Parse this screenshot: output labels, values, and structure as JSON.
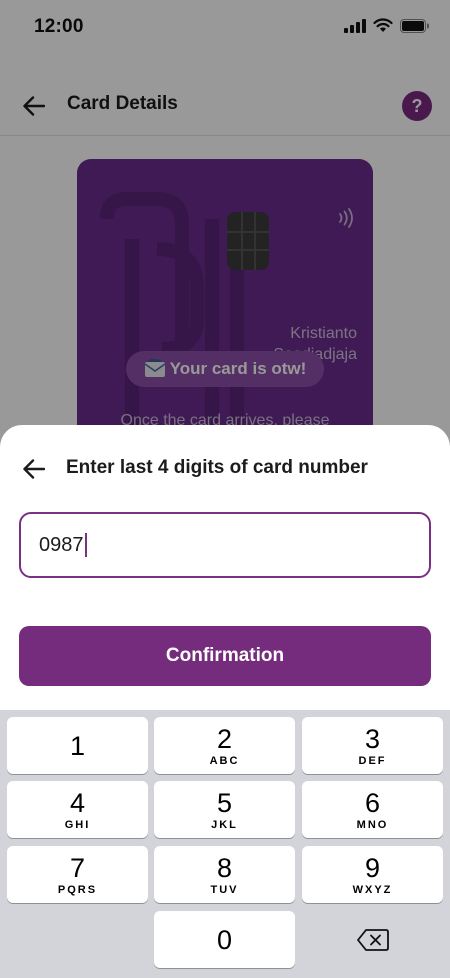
{
  "status_bar": {
    "time": "12:00"
  },
  "header": {
    "title": "Card Details",
    "help_label": "?"
  },
  "card": {
    "holder_line1": "Kristianto",
    "holder_line2": "Soedjadjaja",
    "status_pill": "Your card is otw!",
    "hint": "Once the card arrives, please"
  },
  "sheet": {
    "title": "Enter last 4 digits of card number",
    "input_value": "0987",
    "confirm_label": "Confirmation"
  },
  "keypad": {
    "keys": [
      {
        "digit": "1",
        "letters": ""
      },
      {
        "digit": "2",
        "letters": "ABC"
      },
      {
        "digit": "3",
        "letters": "DEF"
      },
      {
        "digit": "4",
        "letters": "GHI"
      },
      {
        "digit": "5",
        "letters": "JKL"
      },
      {
        "digit": "6",
        "letters": "MNO"
      },
      {
        "digit": "7",
        "letters": "PQRS"
      },
      {
        "digit": "8",
        "letters": "TUV"
      },
      {
        "digit": "9",
        "letters": "WXYZ"
      },
      {
        "digit": "0",
        "letters": ""
      }
    ]
  },
  "colors": {
    "brand_purple": "#752c7d",
    "card_purple": "#6b2c8e",
    "keypad_bg": "#d2d4d9"
  }
}
